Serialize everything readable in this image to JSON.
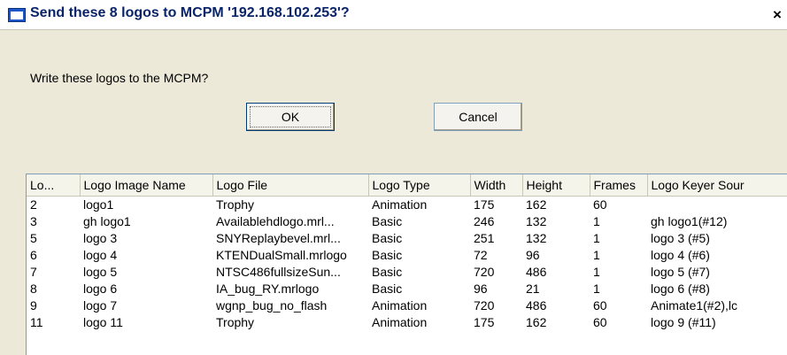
{
  "window": {
    "title": "Send these 8 logos to MCPM '192.168.102.253'?",
    "close_glyph": "×",
    "icon": "app-window-icon"
  },
  "prompt": "Write these logos to the MCPM?",
  "buttons": {
    "ok": "OK",
    "cancel": "Cancel"
  },
  "table": {
    "columns": [
      "Lo...",
      "Logo Image Name",
      "Logo File",
      "Logo Type",
      "Width",
      "Height",
      "Frames",
      "Logo Keyer Sour"
    ],
    "rows": [
      [
        "2",
        "logo1",
        "Trophy",
        "Animation",
        "175",
        "162",
        "60",
        ""
      ],
      [
        "3",
        "gh logo1",
        "Availablehdlogo.mrl...",
        "Basic",
        "246",
        "132",
        "1",
        "gh logo1(#12)"
      ],
      [
        "5",
        "logo 3",
        "SNYReplaybevel.mrl...",
        "Basic",
        "251",
        "132",
        "1",
        "logo 3  (#5)"
      ],
      [
        "6",
        "logo 4",
        "KTENDualSmall.mrlogo",
        "Basic",
        "72",
        "96",
        "1",
        "logo 4  (#6)"
      ],
      [
        "7",
        "logo 5",
        "NTSC486fullsizeSun...",
        "Basic",
        "720",
        "486",
        "1",
        "logo 5  (#7)"
      ],
      [
        "8",
        "logo 6",
        "IA_bug_RY.mrlogo",
        "Basic",
        "96",
        "21",
        "1",
        "logo 6  (#8)"
      ],
      [
        "9",
        "logo 7",
        "wgnp_bug_no_flash",
        "Animation",
        "720",
        "486",
        "60",
        "Animate1(#2),lc"
      ],
      [
        "11",
        "logo 11",
        "Trophy",
        "Animation",
        "175",
        "162",
        "60",
        "logo 9  (#11)"
      ]
    ]
  }
}
